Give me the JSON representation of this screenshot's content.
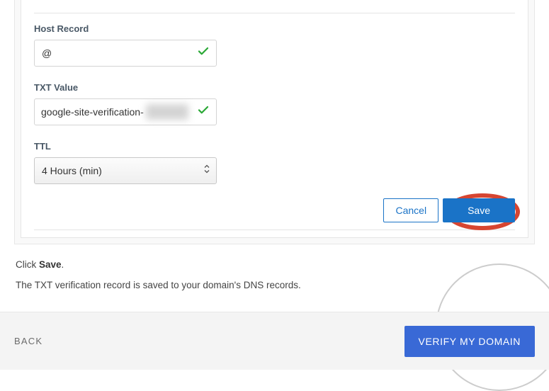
{
  "form": {
    "hostRecord": {
      "label": "Host Record",
      "value": "@",
      "valid": true
    },
    "txtValue": {
      "label": "TXT Value",
      "value": "google-site-verification-",
      "valid": true
    },
    "ttl": {
      "label": "TTL",
      "selectedValue": "4 Hours (min)"
    },
    "actions": {
      "cancel": "Cancel",
      "save": "Save"
    }
  },
  "instructions": {
    "line1_prefix": "Click ",
    "line1_bold": "Save",
    "line1_suffix": ".",
    "line2": "The TXT verification record is saved to your domain's DNS records."
  },
  "footer": {
    "back": "BACK",
    "verify": "VERIFY MY DOMAIN"
  },
  "colors": {
    "primary_blue": "#1a73c7",
    "verify_blue": "#3969d6",
    "check_green": "#2aa836",
    "highlight_red": "#d64531"
  }
}
